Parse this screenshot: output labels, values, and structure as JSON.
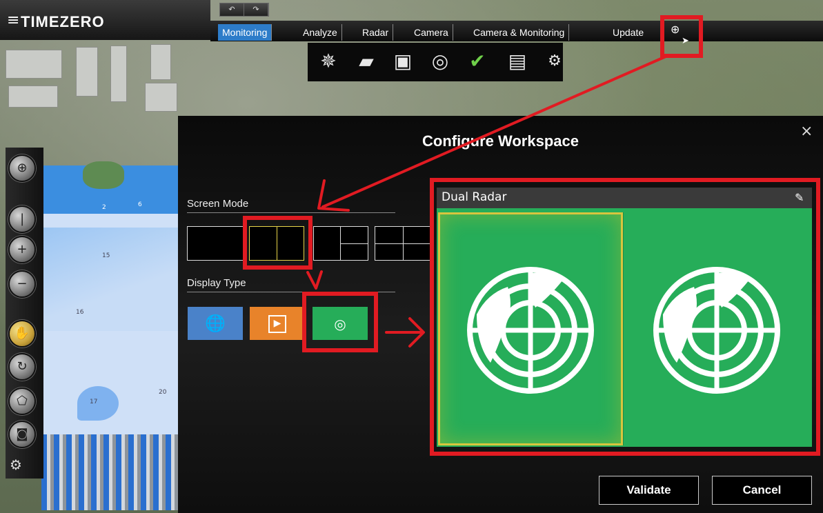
{
  "app": {
    "brand": "TIMEZERO",
    "menu_icon": "hamburger-menu-icon"
  },
  "undo_redo": {
    "undo": "↶",
    "redo": "↷"
  },
  "tabs": [
    {
      "label": "Monitoring",
      "active": true
    },
    {
      "label": "Analyze",
      "active": false
    },
    {
      "label": "Radar",
      "active": false
    },
    {
      "label": "Camera",
      "active": false
    },
    {
      "label": "Camera & Monitoring",
      "active": false
    },
    {
      "label": "Update",
      "active": false
    }
  ],
  "add_tab_icon": "add-workspace-icon",
  "toolbar_icons": [
    "compass-rose-icon",
    "layers-icon",
    "chart-overlay-icon",
    "radar-target-icon",
    "route-check-icon",
    "panel-icon",
    "settings-gears-icon"
  ],
  "left_tools": [
    "target-icon",
    "flashlight-icon",
    "zoom-in-icon",
    "zoom-out-icon",
    "pan-hand-icon",
    "rotate-icon",
    "route-icon",
    "camera-icon"
  ],
  "chart_depths": [
    "15",
    "16",
    "17",
    "20",
    "2",
    "6"
  ],
  "dialog": {
    "title": "Configure Workspace",
    "close": "×",
    "screen_mode_label": "Screen Mode",
    "display_type_label": "Display Type",
    "preview_title": "Dual Radar",
    "validate": "Validate",
    "cancel": "Cancel"
  },
  "display_types": [
    {
      "name": "Chart",
      "color": "#4a82c9",
      "icon": "globe-pin-icon"
    },
    {
      "name": "Video",
      "color": "#e8832a",
      "icon": "play-icon"
    },
    {
      "name": "Radar",
      "color": "#26ad59",
      "icon": "radar-icon"
    }
  ],
  "colors": {
    "highlight_red": "#e11b22",
    "selected_yellow": "#e9d64a",
    "radar_green": "#26ad59",
    "tab_active": "#2d7cc9"
  }
}
